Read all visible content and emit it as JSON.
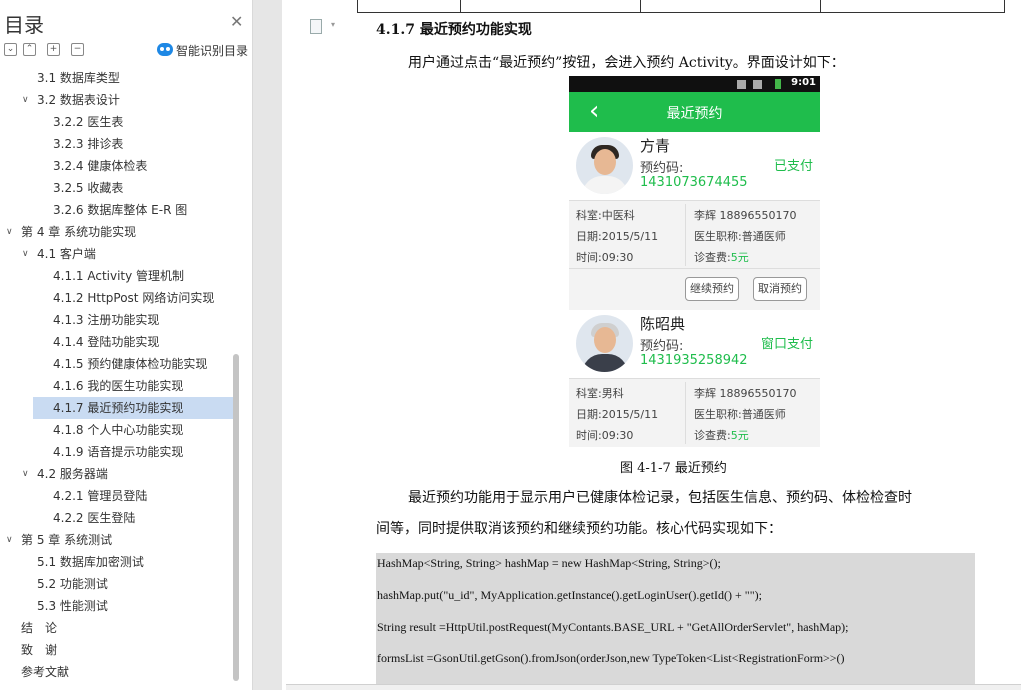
{
  "toc": {
    "title": "目录",
    "smart_label": "智能识别目录",
    "items": [
      {
        "label": "3.1  数据库类型"
      },
      {
        "label": "3.2  数据表设计"
      },
      {
        "label": "3.2.2  医生表"
      },
      {
        "label": "3.2.3  排诊表"
      },
      {
        "label": "3.2.4  健康体检表"
      },
      {
        "label": "3.2.5  收藏表"
      },
      {
        "label": "3.2.6  数据库整体 E-R 图"
      },
      {
        "label": "第 4 章  系统功能实现"
      },
      {
        "label": "4.1  客户端"
      },
      {
        "label": "4.1.1 Activity 管理机制"
      },
      {
        "label": "4.1.2 HttpPost 网络访问实现"
      },
      {
        "label": "4.1.3  注册功能实现"
      },
      {
        "label": "4.1.4  登陆功能实现"
      },
      {
        "label": "4.1.5  预约健康体检功能实现"
      },
      {
        "label": "4.1.6  我的医生功能实现"
      },
      {
        "label": "4.1.7  最近预约功能实现"
      },
      {
        "label": "4.1.8  个人中心功能实现"
      },
      {
        "label": "4.1.9  语音提示功能实现"
      },
      {
        "label": "4.2  服务器端"
      },
      {
        "label": "4.2.1  管理员登陆"
      },
      {
        "label": "4.2.2  医生登陆"
      },
      {
        "label": "第 5 章  系统测试"
      },
      {
        "label": "5.1  数据库加密测试"
      },
      {
        "label": "5.2  功能测试"
      },
      {
        "label": "5.3  性能测试"
      },
      {
        "label": "结　论"
      },
      {
        "label": "致　谢"
      },
      {
        "label": "参考文献"
      }
    ]
  },
  "document": {
    "section_heading": "4.1.7  最近预约功能实现",
    "intro": "用户通过点击“最近预约”按钮，会进入预约 Activity。界面设计如下：",
    "figure_caption": "图 4-1-7    最近预约",
    "para1": "最近预约功能用于显示用户已健康体检记录，包括医生信息、预约码、体检检查时",
    "para2": "间等，同时提供取消该预约和继续预约功能。核心代码实现如下：",
    "code": [
      "HashMap<String, String> hashMap = new HashMap<String, String>();",
      "hashMap.put(\"u_id\", MyApplication.getInstance().getLoginUser().getId() + \"\");",
      "String result =HttpUtil.postRequest(MyContants.BASE_URL + \"GetAllOrderServlet\", hashMap);",
      "formsList =GsonUtil.getGson().fromJson(orderJson,new TypeToken<List<RegistrationForm>>()"
    ]
  },
  "phone": {
    "status_time": "9:01",
    "back_icon": "‹",
    "title": "最近预约",
    "cards": [
      {
        "doctor_name": "方青",
        "code_label": "预约码:",
        "pay_status": "已支付",
        "code_value": "1431073674455",
        "dept": "科室:中医科",
        "contact": "李辉   18896550170",
        "date": "日期:2015/5/11",
        "title_label": "医生职称:普通医师",
        "time": "时间:09:30",
        "fee_label": "诊查费:",
        "fee_value": "5元",
        "btn_continue": "继续预约",
        "btn_cancel": "取消预约"
      },
      {
        "doctor_name": "陈昭典",
        "code_label": "预约码:",
        "pay_status": "窗口支付",
        "code_value": "1431935258942",
        "dept": "科室:男科",
        "contact": "李辉   18896550170",
        "date": "日期:2015/5/11",
        "title_label": "医生职称:普通医师",
        "time": "时间:09:30",
        "fee_label": "诊查费:",
        "fee_value": "5元"
      }
    ]
  },
  "colors": {
    "accent_green": "#1fbd4c",
    "selection": "#c9dbf2"
  }
}
